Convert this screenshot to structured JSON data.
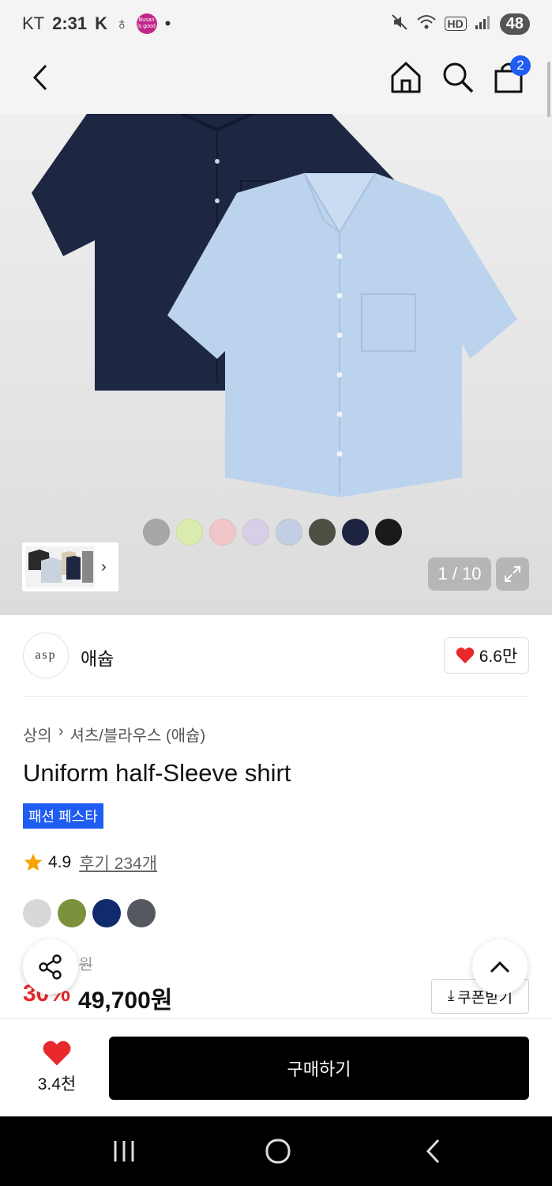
{
  "status_bar": {
    "carrier": "KT",
    "time": "2:31",
    "busan_badge": "Busan is good",
    "hd_label": "HD",
    "battery": "48"
  },
  "nav": {
    "back_icon": "chevron-left-icon",
    "home_icon": "home-icon",
    "search_icon": "search-icon",
    "cart_icon": "shopping-bag-icon",
    "cart_count": "2"
  },
  "hero": {
    "image_alt": "navy and light blue short-sleeve shirts",
    "swatches": [
      "#a7a7a7",
      "#d9ebae",
      "#f0c6c8",
      "#d8cfe6",
      "#c2cee2",
      "#4d5144",
      "#1c2440",
      "#1a1a1a"
    ],
    "page_indicator": "1 / 10",
    "expand_icon": "expand-icon"
  },
  "brand": {
    "logo_text": "asp",
    "name": "애슙",
    "like_count": "6.6만"
  },
  "product": {
    "breadcrumb": [
      "상의",
      "셔츠/블라우스 (애슙)"
    ],
    "title": "Uniform half-Sleeve shirt",
    "promo_badge": "패션 페스타",
    "rating": "4.9",
    "review_link": "후기 234개",
    "color_options": [
      "#d8d8d8",
      "#7c913b",
      "#102a6e",
      "#55595f"
    ],
    "original_price": "원",
    "discount": "30%",
    "sale_price": "49,700원",
    "coupon_label": "쿠폰받기"
  },
  "bottom_bar": {
    "wish_count": "3.4천",
    "buy_label": "구매하기"
  }
}
